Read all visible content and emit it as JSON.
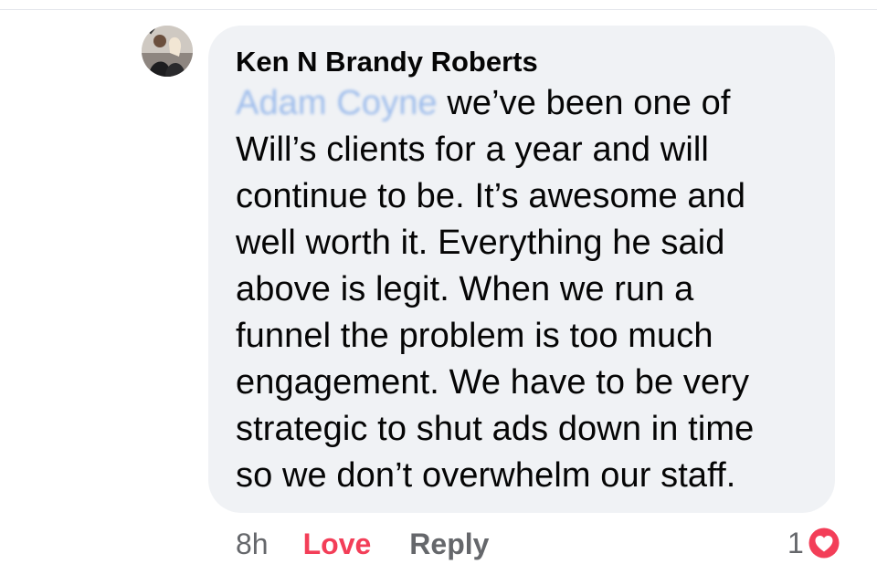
{
  "comment": {
    "author": "Ken N Brandy Roberts",
    "mention": "Adam Coyne",
    "lines": [
      " we’ve been one of",
      "Will’s clients for a year and will",
      "continue to be. It’s awesome and",
      "well worth it. Everything he said",
      "above is legit. When we run a",
      "funnel the problem is too much",
      "engagement. We have to be very",
      "strategic to shut ads down in time",
      "so we don’t overwhelm our staff."
    ]
  },
  "actions": {
    "time": "8h",
    "love_label": "Love",
    "reply_label": "Reply"
  },
  "reactions": {
    "count": "1",
    "icon": "love-reaction-icon",
    "color": "#f33e58"
  },
  "colors": {
    "bubble": "#f0f2f5",
    "love": "#f33e58",
    "meta": "#65676b"
  }
}
